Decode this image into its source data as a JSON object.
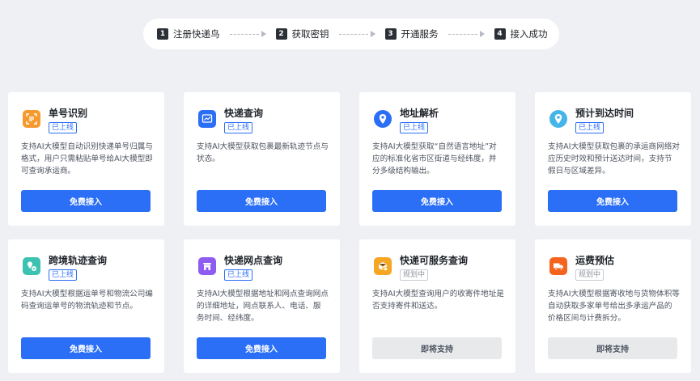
{
  "steps": [
    {
      "num": "1",
      "label": "注册快递鸟"
    },
    {
      "num": "2",
      "label": "获取密钥"
    },
    {
      "num": "3",
      "label": "开通服务"
    },
    {
      "num": "4",
      "label": "接入成功"
    }
  ],
  "cards": [
    {
      "title": "单号识别",
      "badge": "已上线",
      "desc": "支持AI大模型自动识别快递单号归属与格式，用户只需粘贴单号给AI大模型即可查询承运商。",
      "button": "免费接入",
      "icon": "barcode-scan-icon",
      "color": "#f79a2e"
    },
    {
      "title": "快递查询",
      "badge": "已上线",
      "desc": "支持AI大模型获取包裹最新轨迹节点与状态。",
      "button": "免费接入",
      "icon": "tracking-chart-icon",
      "color": "#2b6ff6"
    },
    {
      "title": "地址解析",
      "badge": "已上线",
      "desc": "支持AI大模型获取“自然语言地址”对应的标准化省市区街道与经纬度，并分多级结构输出。",
      "button": "免费接入",
      "icon": "location-pin-icon",
      "color": "#2b6ff6"
    },
    {
      "title": "预计到达时间",
      "badge": "已上线",
      "desc": "支持AI大模型获取包裹的承运商网络对应历史时效和预计送达时间，支持节假日与区域差异。",
      "button": "免费接入",
      "icon": "eta-pin-icon",
      "color": "#45b5e8"
    },
    {
      "title": "跨境轨迹查询",
      "badge": "已上线",
      "desc": "支持AI大模型根据运单号和物流公司编码查询运单号的物流轨迹和节点。",
      "button": "免费接入",
      "icon": "cross-border-map-icon",
      "color": "#3cc2b0"
    },
    {
      "title": "快递网点查询",
      "badge": "已上线",
      "desc": "支持AI大模型根据地址和网点查询网点的详细地址，网点联系人、电话、服务时间、经纬度。",
      "button": "免费接入",
      "icon": "outlet-store-icon",
      "color": "#8e5cf0"
    },
    {
      "title": "快递可服务查询",
      "badge": "规划中",
      "desc": "支持AI大模型查询用户的收寄件地址是否支持寄件和送达。",
      "button": "即将支持",
      "icon": "service-box-icon",
      "color": "#f5a623"
    },
    {
      "title": "运费预估",
      "badge": "规划中",
      "desc": "支持AI大模型根据寄收地与货物体积等自动获取多家单号给出多承运产品的价格区间与计费拆分。",
      "button": "即将支持",
      "icon": "freight-truck-icon",
      "color": "#f5641e"
    }
  ]
}
